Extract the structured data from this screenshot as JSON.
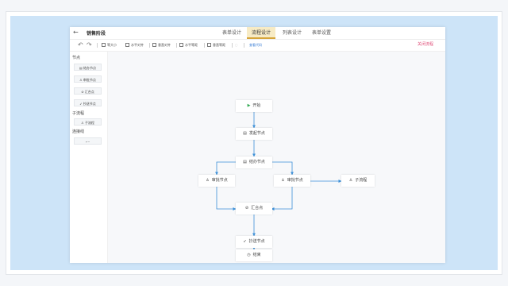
{
  "header": {
    "back_icon": "←",
    "title": "销售阶段",
    "tabs": [
      "表单设计",
      "流程设计",
      "列表设计",
      "表单设置"
    ],
    "active_tab": "流程设计"
  },
  "toolbar": {
    "undo_icon": "↶",
    "redo_icon": "↷",
    "items": [
      "等大小",
      "水平对齐",
      "垂直对齐",
      "水平等距",
      "垂直等距"
    ],
    "view_code": "查看代码",
    "close_flow": "关闭流程"
  },
  "sidebar": {
    "section_nodes": "节点",
    "node_items": [
      "结办节点",
      "审批节点",
      "汇合点",
      "抄送节点"
    ],
    "section_subflow": "子流程",
    "subflow_items": [
      "子流程"
    ],
    "section_connect": "连接线",
    "connect_icon": "connector-icon"
  },
  "flow": {
    "start": "开始",
    "initiate": "发起节点",
    "handle": "结办节点",
    "approve1": "审批节点",
    "approve2": "审批节点",
    "subflow": "子流程",
    "merge": "汇合点",
    "cc": "抄送节点",
    "end": "结束"
  },
  "colors": {
    "accent": "#3b8fd8",
    "start_icon": "#2fa84f",
    "close": "#e0517b",
    "active_tab_bg": "#f7ebc5"
  }
}
